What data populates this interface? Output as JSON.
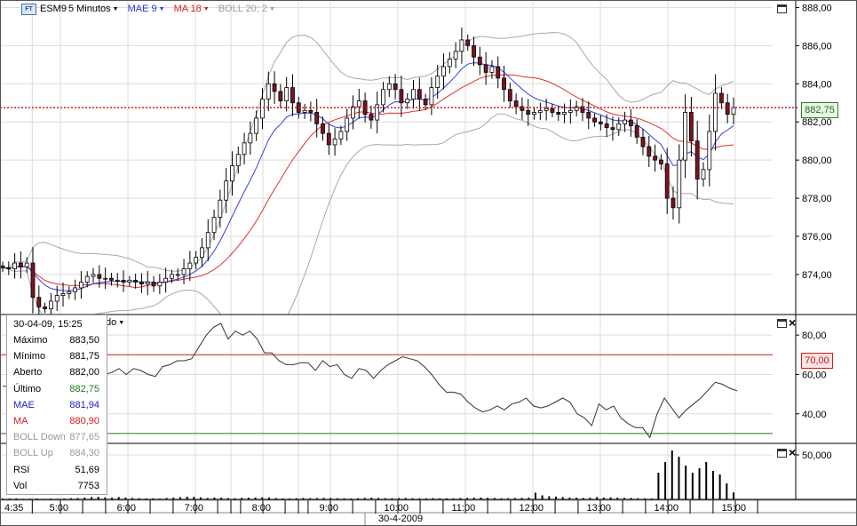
{
  "header": {
    "symbol": "ESM9",
    "timeframe": "5 Minutos",
    "mae": "MAE 9",
    "ma": "MA 18",
    "boll": "BOLL 20; 2",
    "rsi_partial": "do"
  },
  "colors": {
    "up": "#ffffff",
    "down": "#7a1420",
    "mae": "#3344dd",
    "ma": "#e03030",
    "boll": "#a8a8a8",
    "last_price_line": "#cc2020",
    "rsi_70": "#cc2020",
    "rsi_30": "#1f7a1f"
  },
  "price_tag": "882,75",
  "rsi_tag": "70,00",
  "date_label": "30-4-2009",
  "info": {
    "date": "30-04-09, 15:25",
    "rows": [
      {
        "label": "Máximo",
        "value": "883,50",
        "color": "black"
      },
      {
        "label": "Mínimo",
        "value": "881,75",
        "color": "black"
      },
      {
        "label": "Aberto",
        "value": "882,00",
        "color": "black"
      },
      {
        "label": "Último",
        "value": "882,75",
        "color": "green"
      },
      {
        "label": "MAE",
        "value": "881,94",
        "color": "blue"
      },
      {
        "label": "MA",
        "value": "880,90",
        "color": "red"
      },
      {
        "label": "BOLL Down",
        "value": "877,65",
        "color": "gray"
      },
      {
        "label": "BOLL Up",
        "value": "884,30",
        "color": "gray"
      },
      {
        "label": "RSI",
        "value": "51,69",
        "color": "black"
      },
      {
        "label": "Vol",
        "value": "7753",
        "color": "black"
      }
    ]
  },
  "chart_data": {
    "type": "candlestick",
    "x_tick_labels": [
      "4:35",
      "5:00",
      "6:00",
      "7:00",
      "8:00",
      "9:00",
      "10:00",
      "11:00",
      "12:00",
      "13:00",
      "14:00",
      "15:00"
    ],
    "x_tick_times": [
      4.5833,
      5.0,
      6.0,
      7.0,
      8.0,
      9.0,
      10.0,
      11.0,
      12.0,
      13.0,
      14.0,
      15.0
    ],
    "price_axis": {
      "ticks": [
        874,
        876,
        878,
        880,
        882,
        884,
        886,
        888
      ],
      "labels": [
        "874,00",
        "876,00",
        "878,00",
        "880,00",
        "882,00",
        "884,00",
        "886,00",
        "888,00"
      ],
      "ylim": [
        871.9,
        888.3
      ]
    },
    "rsi_axis": {
      "ticks": [
        40,
        60,
        80
      ],
      "labels": [
        "40,00",
        "60,00",
        "80,00"
      ],
      "ylim": [
        25,
        90
      ],
      "levels": [
        70,
        30
      ]
    },
    "vol_axis": {
      "ticks": [
        50000
      ],
      "labels": [
        "50,000"
      ],
      "ylim": [
        0,
        62000
      ]
    },
    "last_price": 882.75,
    "close": [
      874.35,
      874.3,
      874.6,
      874.4,
      874.6,
      872.8,
      872.3,
      872.2,
      872.6,
      872.9,
      873.0,
      873.1,
      873.3,
      873.6,
      873.9,
      874.0,
      873.8,
      873.8,
      873.7,
      873.7,
      873.6,
      873.7,
      873.6,
      873.5,
      873.6,
      873.4,
      873.6,
      873.8,
      874.0,
      874.0,
      874.3,
      874.6,
      874.9,
      875.4,
      876.2,
      877.0,
      877.9,
      878.9,
      879.7,
      880.3,
      880.9,
      881.4,
      882.2,
      883.2,
      884.0,
      883.6,
      883.1,
      883.8,
      883.0,
      882.5,
      882.6,
      882.5,
      881.9,
      881.4,
      880.8,
      881.1,
      881.5,
      882.2,
      882.8,
      883.1,
      882.4,
      882.1,
      882.9,
      883.7,
      884.0,
      883.7,
      883.0,
      883.2,
      883.7,
      883.2,
      882.9,
      883.8,
      884.4,
      884.9,
      885.3,
      885.7,
      886.3,
      886.0,
      885.4,
      885.0,
      884.6,
      884.9,
      884.3,
      883.7,
      883.1,
      882.8,
      882.6,
      882.4,
      882.5,
      882.6,
      882.7,
      882.5,
      882.4,
      882.5,
      882.6,
      882.8,
      882.5,
      882.2,
      882.0,
      881.9,
      881.7,
      881.6,
      881.9,
      882.1,
      881.8,
      881.2,
      880.7,
      880.2,
      880.0,
      879.8,
      878.0,
      877.5,
      880.0,
      882.5,
      881.0,
      879.0,
      879.5,
      881.5,
      883.5,
      883.0,
      882.4,
      882.75
    ],
    "rsi": [
      54,
      54,
      52,
      54,
      53,
      52,
      52,
      52,
      52,
      52,
      56,
      52,
      53,
      58,
      60,
      61,
      63,
      60,
      63,
      62,
      60,
      59,
      64,
      65,
      67,
      67,
      68,
      74,
      80,
      84,
      86,
      78,
      82,
      80,
      82,
      78,
      71,
      71,
      67,
      65,
      65,
      66,
      66,
      62,
      67,
      64,
      65,
      60,
      58,
      63,
      62,
      58,
      62,
      65,
      67,
      69,
      68,
      67,
      64,
      60,
      55,
      51,
      51,
      50,
      46,
      43,
      41,
      42,
      44,
      42,
      45,
      46,
      48,
      44,
      43,
      44,
      46,
      48,
      46,
      40,
      38,
      34,
      45,
      42,
      44,
      38,
      35,
      33,
      33,
      28,
      40,
      48,
      43,
      38,
      42,
      45,
      48,
      52,
      56,
      55,
      53,
      51.69
    ],
    "volume": [
      800,
      900,
      1000,
      700,
      800,
      900,
      600,
      800,
      700,
      900,
      1200,
      1400,
      2000,
      2500,
      2800,
      2200,
      1800,
      2600,
      2000,
      1500,
      1200,
      1000,
      1100,
      900,
      1500,
      2000,
      2400,
      3000,
      2800,
      2200,
      1500,
      2000,
      1800,
      1400,
      1200,
      1600,
      1800,
      2000,
      2200,
      2000,
      1400,
      1100,
      1000,
      1200,
      1500,
      1300,
      1400,
      1600,
      1500,
      1200,
      1100,
      1000,
      1200,
      1600,
      1800,
      1500,
      1300,
      1200,
      1400,
      1500,
      1200,
      1000,
      1100,
      1300,
      1200,
      1100,
      1000,
      1400,
      1600,
      1800,
      2000,
      1700,
      1500,
      1200,
      1300,
      1400,
      1600,
      1800,
      7500,
      4500,
      3500,
      3000,
      2500,
      2000,
      1800,
      1500,
      1800,
      2500,
      2000,
      2200,
      1800,
      1600,
      1500,
      1200,
      1100,
      1000,
      30000,
      42000,
      55000,
      48000,
      38000,
      30000,
      35000,
      42000,
      32000,
      28000,
      18000,
      7753
    ]
  }
}
